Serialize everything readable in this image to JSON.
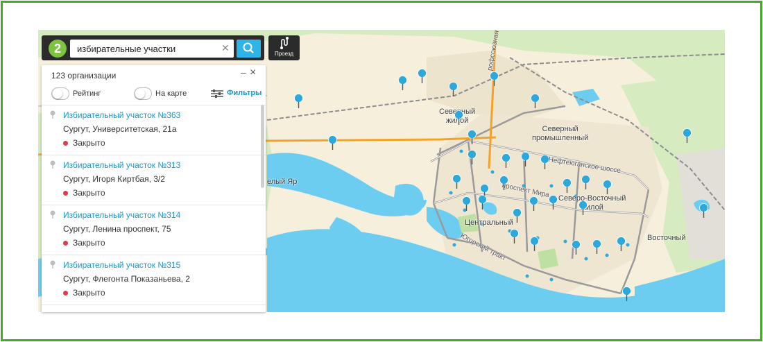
{
  "search": {
    "query": "избирательные участки",
    "logo_text": "2",
    "clear_icon": "close-icon",
    "search_icon": "search-icon"
  },
  "route": {
    "label": "Проезд",
    "icon": "route-icon"
  },
  "panel": {
    "count": "123 организации",
    "minimize": "–",
    "close": "×",
    "rating_label": "Рейтинг",
    "on_map_label": "На карте",
    "filters_label": "Фильтры",
    "items": [
      {
        "title": "Избирательный участок №363",
        "address": "Сургут, Университетская, 21а",
        "status": "Закрыто"
      },
      {
        "title": "Избирательный участок №313",
        "address": "Сургут, Игоря Киртбая, 3/2",
        "status": "Закрыто"
      },
      {
        "title": "Избирательный участок №314",
        "address": "Сургут, Ленина проспект, 75",
        "status": "Закрыто"
      },
      {
        "title": "Избирательный участок №315",
        "address": "Сургут, Флегонта Показаньева, 2",
        "status": "Закрыто"
      }
    ]
  },
  "map": {
    "labels": {
      "severny_zhiloy": "Северный\nжилой",
      "severny_prom": "Северный\nпромышленный",
      "severo_vost": "Северо-Восточный\nжилой",
      "centralny": "Центральный",
      "vostochny": "Восточный",
      "yar": "елый Яр"
    },
    "roads": {
      "nefteyugansk": "Нефтеюганское шоссе",
      "mira": "проспект Мира",
      "yugorsky": "Югорский тракт",
      "profsoyuznaya": "рофсоюзная"
    },
    "colors": {
      "water": "#6ccdf0",
      "land": "#f5efdc",
      "park": "#cfe7b4",
      "pin": "#2ea8d9",
      "road_main": "#f4a12a",
      "frame": "#45a928"
    }
  }
}
